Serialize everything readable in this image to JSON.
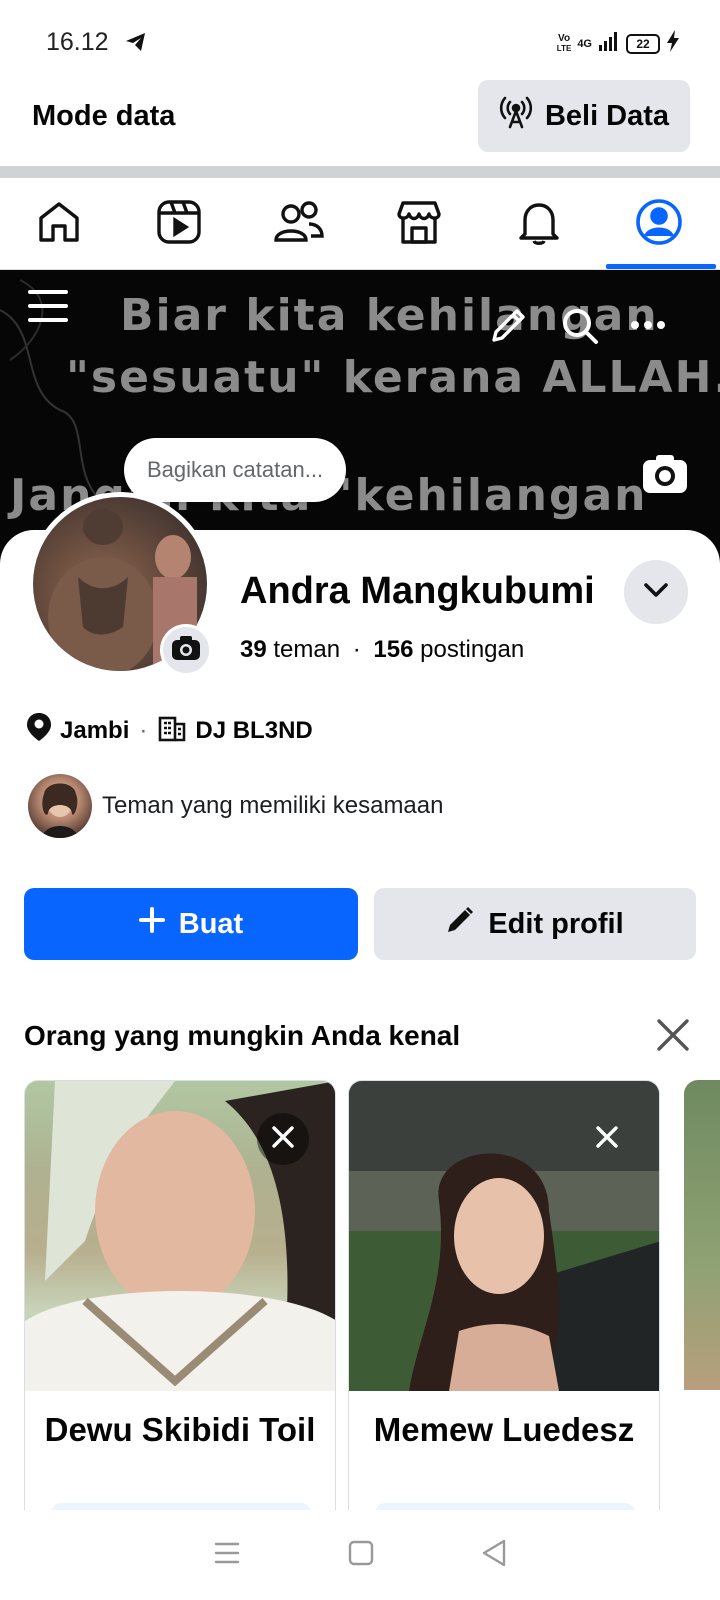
{
  "status_bar": {
    "time": "16.12",
    "volte_top": "Vo",
    "volte_bottom": "LTE",
    "network": "4G",
    "battery": "22"
  },
  "data_mode": {
    "title": "Mode data",
    "buy_label": "Beli Data"
  },
  "nav": {
    "items": [
      {
        "icon": "home-icon"
      },
      {
        "icon": "video-icon"
      },
      {
        "icon": "friends-icon"
      },
      {
        "icon": "marketplace-icon"
      },
      {
        "icon": "bell-icon"
      },
      {
        "icon": "profile-icon"
      }
    ],
    "active_color": "#0866ff"
  },
  "cover": {
    "line1": "Biar kita kehilangan",
    "line2": "\"sesuatu\" kerana ALLAH...",
    "line3": "Jangan kita \"kehilangan"
  },
  "note": {
    "placeholder": "Bagikan catatan..."
  },
  "profile": {
    "name": "Andra Mangkubumi",
    "friends_count": "39",
    "friends_label": "teman",
    "separator": "·",
    "posts_count": "156",
    "posts_label": "postingan",
    "location": "Jambi",
    "meta_separator": "·",
    "workplace": "DJ BL3ND",
    "mutual_text": "Teman yang memiliki kesamaan"
  },
  "actions": {
    "create_label": "Buat",
    "edit_label": "Edit profil"
  },
  "pymk": {
    "title": "Orang yang mungkin Anda kenal",
    "people": [
      {
        "name": "Dewu Skibidi Toil"
      },
      {
        "name": "Memew Luedesz"
      }
    ]
  },
  "colors": {
    "primary": "#0866ff",
    "secondary_bg": "#e4e6eb"
  }
}
